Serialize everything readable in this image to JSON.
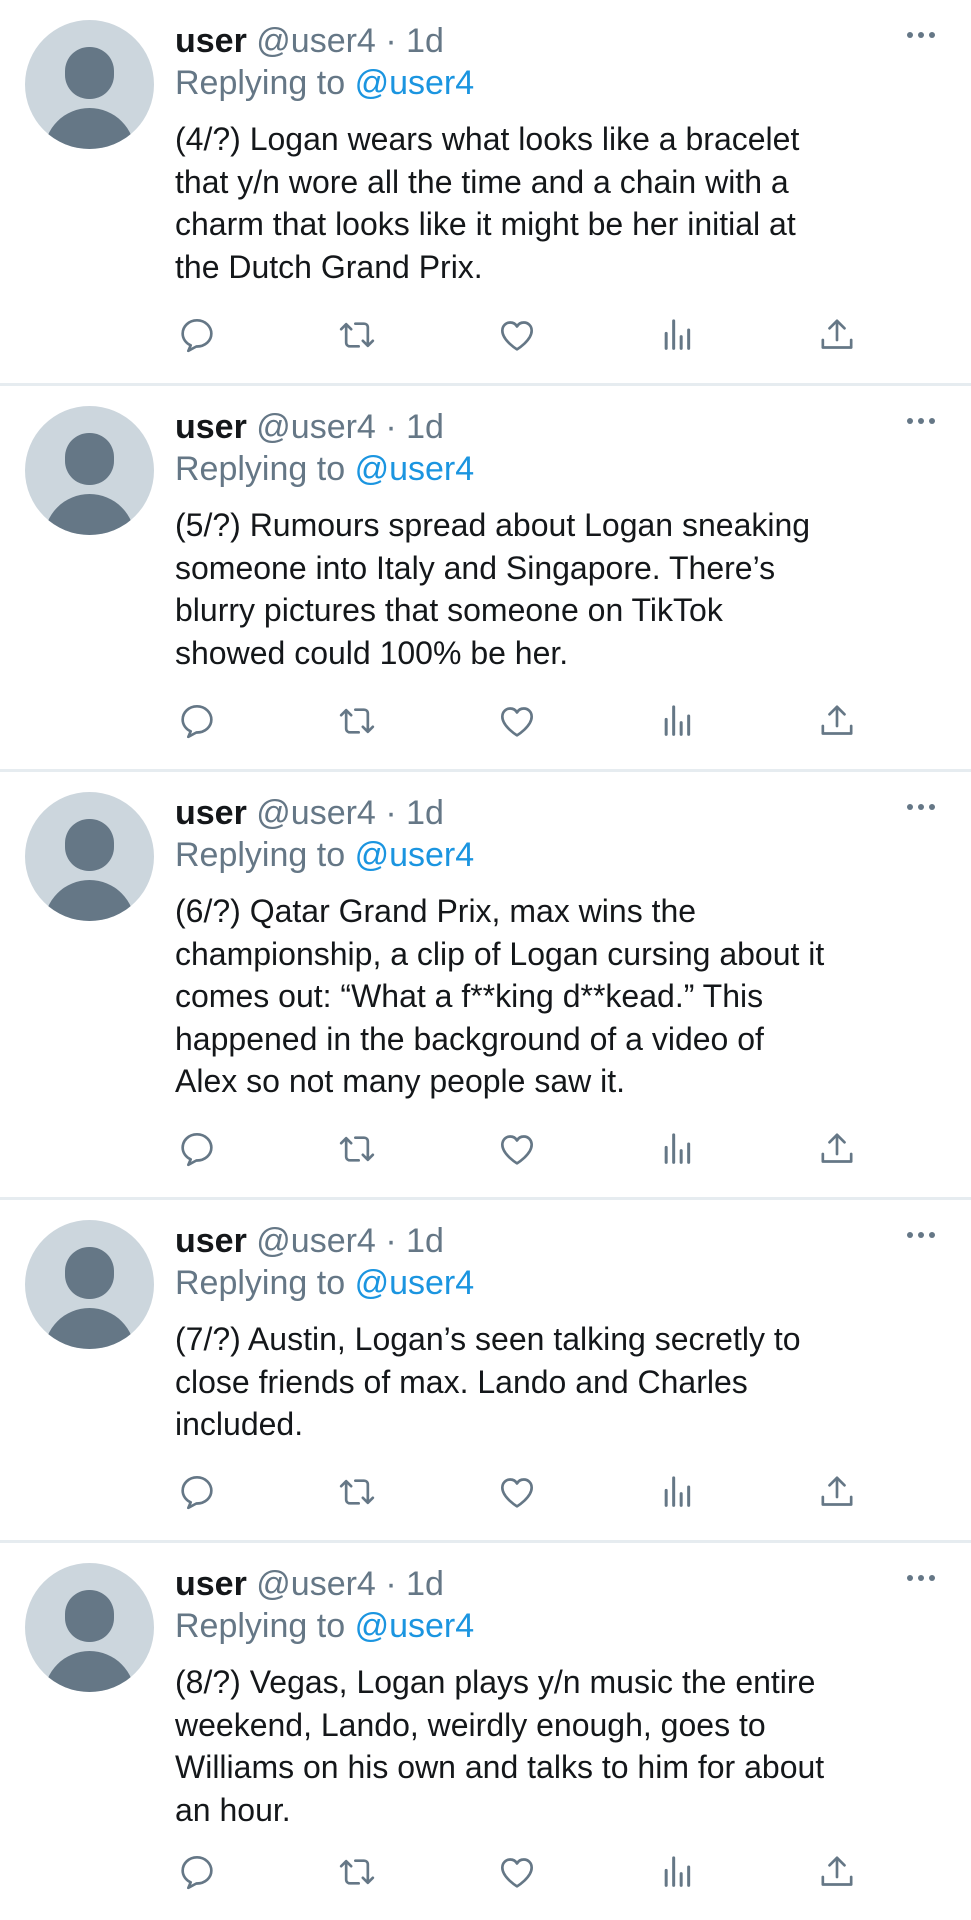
{
  "tweets": [
    {
      "display_name": "user",
      "handle": "@user4",
      "separator": "·",
      "time": "1d",
      "replying_label": "Replying to",
      "replying_to": "@user4",
      "text": "(4/?) Logan wears what looks like a bracelet\nthat y/n wore all the time and a chain with a\ncharm that looks like it might be her initial at\nthe Dutch Grand Prix."
    },
    {
      "display_name": "user",
      "handle": "@user4",
      "separator": "·",
      "time": "1d",
      "replying_label": "Replying to",
      "replying_to": "@user4",
      "text": "(5/?) Rumours spread about Logan sneaking\nsomeone into Italy and Singapore. There’s\nblurry pictures that someone on TikTok\nshowed could 100% be her."
    },
    {
      "display_name": "user",
      "handle": "@user4",
      "separator": "·",
      "time": "1d",
      "replying_label": "Replying to",
      "replying_to": "@user4",
      "text": "(6/?) Qatar Grand Prix, max wins the\nchampionship, a clip of Logan cursing about it\ncomes out: “What a f**king d**kead.” This\nhappened in the background of a video of\nAlex so not many people saw it."
    },
    {
      "display_name": "user",
      "handle": "@user4",
      "separator": "·",
      "time": "1d",
      "replying_label": "Replying to",
      "replying_to": "@user4",
      "text": "(7/?) Austin, Logan’s seen talking secretly to\nclose friends of max. Lando and Charles\nincluded."
    },
    {
      "display_name": "user",
      "handle": "@user4",
      "separator": "·",
      "time": "1d",
      "replying_label": "Replying to",
      "replying_to": "@user4",
      "text": "(8/?) Vegas, Logan plays y/n music the entire\nweekend, Lando, weirdly enough, goes to\nWilliams on his own and talks to him for about\nan hour."
    }
  ],
  "icons": {
    "more": "more-horizontal-icon",
    "reply": "reply-icon",
    "retweet": "retweet-icon",
    "like": "heart-icon",
    "stats": "analytics-icon",
    "share": "share-icon"
  },
  "colors": {
    "text": "#14171a",
    "secondary": "#657786",
    "link": "#1b95e0",
    "avatar_bg": "#ccd6dd",
    "divider": "#e6ecf0"
  }
}
